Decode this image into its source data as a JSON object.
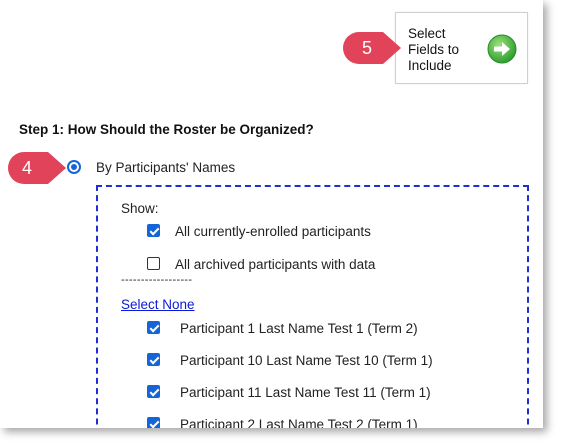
{
  "next_step": {
    "label": "Select\nFields to\nInclude",
    "icon": "arrow-right-circle-icon",
    "icon_color": "#3bb33b"
  },
  "callouts": [
    {
      "number": "5",
      "color": "#e0435a"
    },
    {
      "number": "4",
      "color": "#e0435a"
    }
  ],
  "step1": {
    "heading": "Step 1: How Should the Roster be Organized?",
    "option_label": "By Participants' Names",
    "option_selected": true
  },
  "show": {
    "label": "Show:",
    "options": [
      {
        "label": "All currently-enrolled participants",
        "checked": true
      },
      {
        "label": "All archived participants with data",
        "checked": false
      }
    ],
    "divider": "------------------"
  },
  "select_none_label": "Select None",
  "participants": [
    {
      "label": "Participant 1 Last Name Test 1 (Term 2)",
      "checked": true
    },
    {
      "label": "Participant 10 Last Name Test 10 (Term 1)",
      "checked": true
    },
    {
      "label": "Participant 11 Last Name Test 11 (Term 1)",
      "checked": true
    },
    {
      "label": "Participant 2 Last Name Test 2 (Term 1)",
      "checked": true
    }
  ],
  "colors": {
    "accent_blue": "#1565d8",
    "dashed_border": "#1f2fd1",
    "link": "#0b1ad6"
  }
}
